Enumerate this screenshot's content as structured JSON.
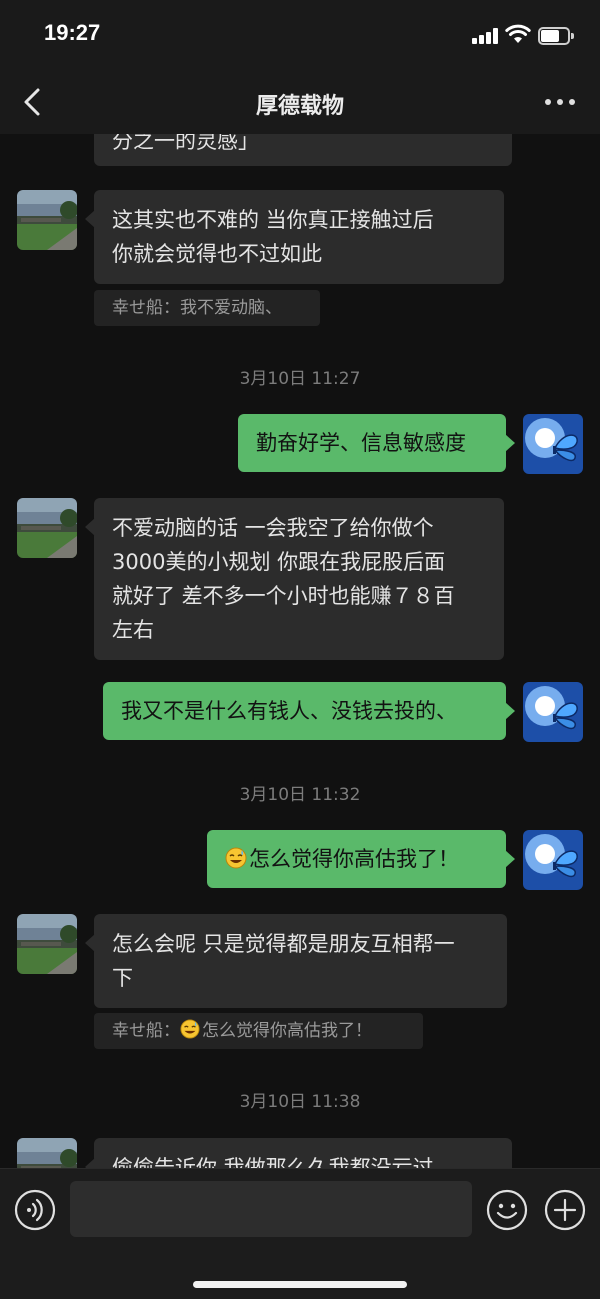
{
  "status_bar": {
    "time": "19:27",
    "battery_level": 0.7
  },
  "header": {
    "title": "厚德载物",
    "back_icon": "chevron-left-icon",
    "more_icon": "ellipsis-icon"
  },
  "colors": {
    "sent_bubble": "#5ab96a",
    "received_bubble": "#2c2c2c",
    "background": "#111111"
  },
  "messages": [
    {
      "side": "left",
      "lines": [
        "分之一的灵感」"
      ]
    },
    {
      "side": "left",
      "lines": [
        "这其实也不难的 当你真正接触过后",
        "你就会觉得也不过如此"
      ],
      "quote": "幸せ船：我不爱动脑、"
    },
    {
      "type": "time",
      "text": "3月10日 11:27"
    },
    {
      "side": "right",
      "text": "勤奋好学、信息敏感度"
    },
    {
      "side": "left",
      "lines": [
        "不爱动脑的话 一会我空了给你做个",
        "3000美的小规划 你跟在我屁股后面",
        "就好了 差不多一个小时也能赚７８百",
        "左右"
      ]
    },
    {
      "side": "right",
      "text": "我又不是什么有钱人、没钱去投的、"
    },
    {
      "type": "time",
      "text": "3月10日 11:32"
    },
    {
      "side": "right",
      "emoji": "sweat-smile-emoji",
      "text": "怎么觉得你高估我了！"
    },
    {
      "side": "left",
      "lines": [
        "怎么会呢 只是觉得都是朋友互相帮一",
        "下"
      ],
      "quote_prefix": "幸せ船：",
      "quote_emoji": "sweat-smile-emoji",
      "quote_text": "怎么觉得你高估我了！"
    },
    {
      "type": "time",
      "text": "3月10日 11:38"
    },
    {
      "side": "left",
      "lines": [
        "偷偷告诉你 我做那么久我都没亏过"
      ]
    }
  ],
  "input_bar": {
    "placeholder": "",
    "voice_icon": "voice-icon",
    "emoji_icon": "smiley-icon",
    "add_icon": "plus-circle-icon"
  }
}
